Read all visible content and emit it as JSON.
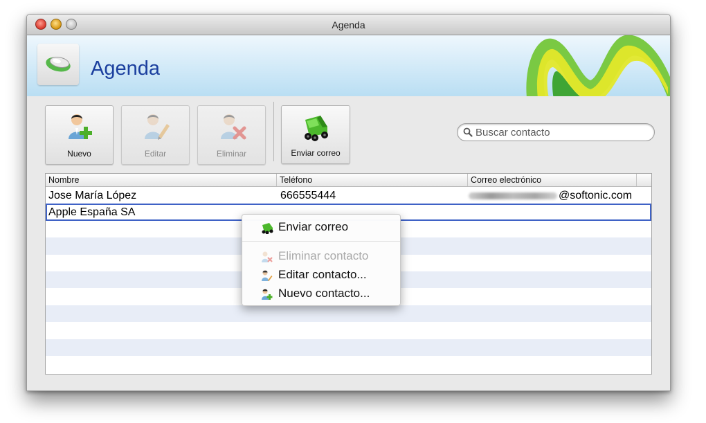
{
  "window": {
    "title": "Agenda"
  },
  "header": {
    "app_title": "Agenda"
  },
  "toolbar": {
    "buttons": [
      {
        "label": "Nuevo",
        "enabled": true,
        "icon": "add-user-icon"
      },
      {
        "label": "Editar",
        "enabled": false,
        "icon": "edit-user-icon"
      },
      {
        "label": "Eliminar",
        "enabled": false,
        "icon": "delete-user-icon"
      },
      {
        "label": "Enviar correo",
        "enabled": true,
        "icon": "truck-icon"
      }
    ]
  },
  "search": {
    "placeholder": "Buscar contacto",
    "value": ""
  },
  "table": {
    "columns": [
      "Nombre",
      "Teléfono",
      "Correo electrónico"
    ],
    "rows": [
      {
        "name": "Jose María López",
        "phone": "666555444",
        "email": "@softonic.com"
      },
      {
        "name": "Apple España SA",
        "phone": "",
        "email": ""
      }
    ]
  },
  "context_menu": {
    "items": [
      {
        "label": "Enviar correo",
        "enabled": true,
        "icon": "truck-icon"
      },
      {
        "label": "Eliminar contacto",
        "enabled": false,
        "icon": "delete-user-icon"
      },
      {
        "label": "Editar contacto...",
        "enabled": true,
        "icon": "edit-user-icon"
      },
      {
        "label": "Nuevo contacto...",
        "enabled": true,
        "icon": "add-user-icon"
      }
    ]
  },
  "colors": {
    "accent_blue": "#1b3f9e",
    "selection_outline": "#3f62c6",
    "brand_green": "#7ac943",
    "brand_yellow": "#e3e82a"
  }
}
